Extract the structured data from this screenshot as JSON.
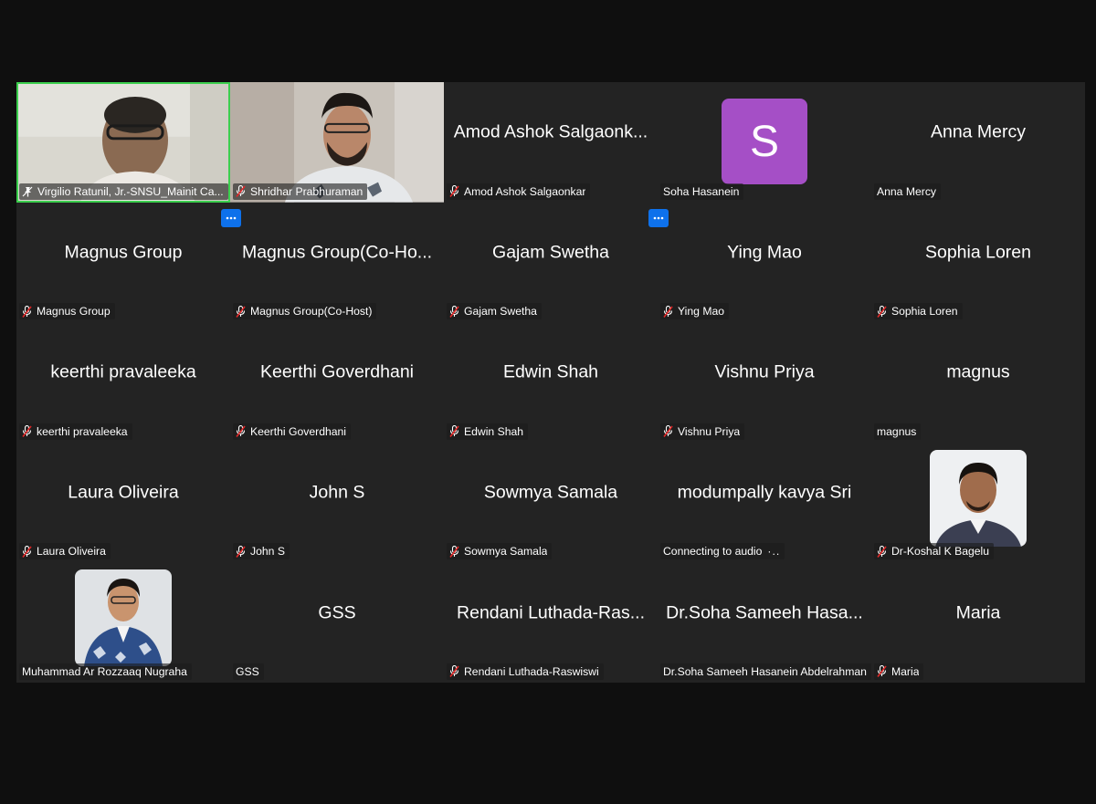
{
  "gallery": {
    "tiles": [
      {
        "name": "Virgilio Ratunil, Jr.-SNSU_Mainit Ca...",
        "display": "Virgilio Ratunil, Jr.-SNSU_Mainit Ca...",
        "mode": "video",
        "icon": "pin-icon"
      },
      {
        "name": "Shridhar Prabhuraman",
        "display": "",
        "mode": "video",
        "icon": "mic-muted-icon"
      },
      {
        "name": "Amod Ashok Salgaonkar",
        "display": "Amod Ashok Salgaonk...",
        "mode": "text",
        "icon": "mic-muted-icon"
      },
      {
        "name": "Soha Hasanein",
        "display": "S",
        "mode": "letter",
        "icon": ""
      },
      {
        "name": "Anna Mercy",
        "display": "Anna Mercy",
        "mode": "text",
        "icon": ""
      },
      {
        "name": "Magnus Group",
        "display": "Magnus Group",
        "mode": "text",
        "icon": "mic-muted-icon"
      },
      {
        "name": "Magnus Group(Co-Host)",
        "display": "Magnus Group(Co-Ho...",
        "mode": "text",
        "icon": "mic-muted-icon"
      },
      {
        "name": "Gajam Swetha",
        "display": "Gajam Swetha",
        "mode": "text",
        "icon": "mic-muted-icon"
      },
      {
        "name": "Ying Mao",
        "display": "Ying Mao",
        "mode": "text",
        "icon": "mic-muted-icon"
      },
      {
        "name": "Sophia Loren",
        "display": "Sophia Loren",
        "mode": "text",
        "icon": "mic-muted-icon"
      },
      {
        "name": "keerthi pravaleeka",
        "display": "keerthi pravaleeka",
        "mode": "text",
        "icon": "mic-muted-icon"
      },
      {
        "name": "Keerthi Goverdhani",
        "display": "Keerthi Goverdhani",
        "mode": "text",
        "icon": "mic-muted-icon"
      },
      {
        "name": "Edwin Shah",
        "display": "Edwin Shah",
        "mode": "text",
        "icon": "mic-muted-icon"
      },
      {
        "name": "Vishnu Priya",
        "display": "Vishnu Priya",
        "mode": "text",
        "icon": "mic-muted-icon"
      },
      {
        "name": "magnus",
        "display": "magnus",
        "mode": "text",
        "icon": ""
      },
      {
        "name": "Laura Oliveira",
        "display": "Laura Oliveira",
        "mode": "text",
        "icon": "mic-muted-icon"
      },
      {
        "name": "John S",
        "display": "John S",
        "mode": "text",
        "icon": "mic-muted-icon"
      },
      {
        "name": "Sowmya Samala",
        "display": "Sowmya Samala",
        "mode": "text",
        "icon": "mic-muted-icon"
      },
      {
        "name": "Connecting to audio",
        "display": "modumpally kavya Sri",
        "mode": "text",
        "icon": "",
        "connecting": true
      },
      {
        "name": "Dr-Koshal K Bagelu",
        "display": "",
        "mode": "photo",
        "icon": "mic-muted-icon",
        "photo": "man-photo"
      },
      {
        "name": "Muhammad Ar Rozzaaq Nugraha",
        "display": "",
        "mode": "photo",
        "icon": "",
        "photo": "man-batik-photo"
      },
      {
        "name": "GSS",
        "display": "GSS",
        "mode": "text",
        "icon": ""
      },
      {
        "name": "Rendani  Luthada-Raswiswi",
        "display": "Rendani  Luthada-Ras...",
        "mode": "text",
        "icon": "mic-muted-icon"
      },
      {
        "name": "Dr.Soha Sameeh Hasanein Abdelrahman",
        "display": "Dr.Soha Sameeh Hasa...",
        "mode": "text",
        "icon": ""
      },
      {
        "name": "Maria",
        "display": "Maria",
        "mode": "text",
        "icon": "mic-muted-icon"
      }
    ],
    "more_buttons": [
      {
        "after_tile": 0,
        "label": "more-options"
      },
      {
        "after_tile": 2,
        "label": "more-options"
      }
    ]
  },
  "connecting_dots": "·..",
  "colors": {
    "background": "#0f0f0f",
    "tile": "#232323",
    "speaking_border": "#3ccf4e",
    "muted_mic": "#e02828",
    "avatar_purple": "#a54fc6",
    "more_button": "#0e71eb"
  }
}
